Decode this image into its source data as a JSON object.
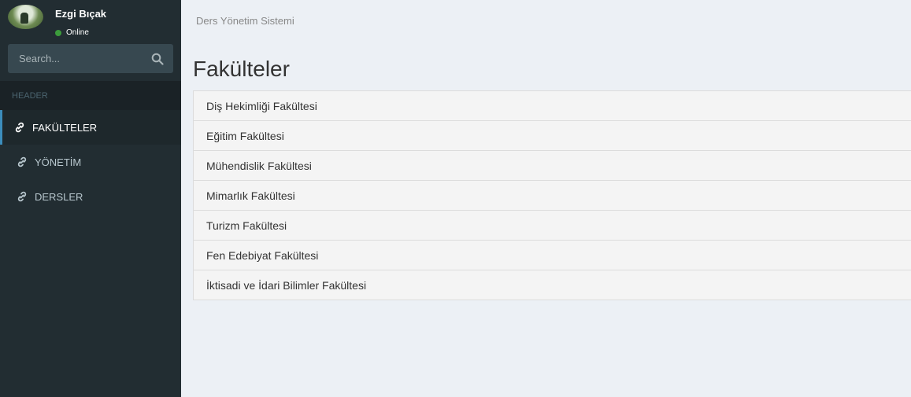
{
  "user": {
    "name": "Ezgi Bıçak",
    "status": "Online"
  },
  "search": {
    "placeholder": "Search..."
  },
  "sidebar": {
    "header": "HEADER",
    "items": [
      {
        "label": "FAKÜLTELER",
        "icon": "link-icon",
        "active": true
      },
      {
        "label": "YÖNETİM",
        "icon": "link-icon",
        "active": false
      },
      {
        "label": "DERSLER",
        "icon": "link-icon",
        "active": false
      }
    ]
  },
  "breadcrumb": "Ders Yönetim Sistemi",
  "page_title": "Fakülteler",
  "faculties": [
    "Diş Hekimliği Fakültesi",
    "Eğitim Fakültesi",
    "Mühendislik Fakültesi",
    "Mimarlık Fakültesi",
    "Turizm Fakültesi",
    "Fen Edebiyat Fakültesi",
    "İktisadi ve İdari Bilimler Fakültesi"
  ],
  "colors": {
    "sidebar_bg": "#222d32",
    "active_accent": "#3c8dbc",
    "content_bg": "#ecf0f5",
    "online": "#3c9c3c"
  }
}
